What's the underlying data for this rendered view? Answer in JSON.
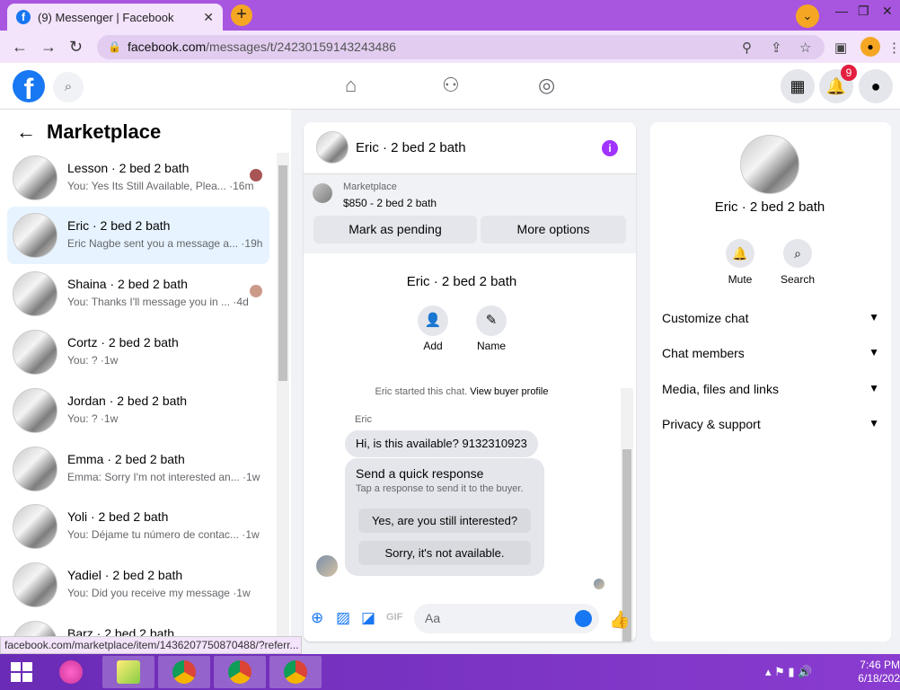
{
  "browser": {
    "tab_title": "(9) Messenger | Facebook",
    "url_host": "facebook.com",
    "url_path": "/messages/t/24230159143243486",
    "status_url": "facebook.com/marketplace/item/1436207750870488/?referr..."
  },
  "header": {
    "notification_count": "9"
  },
  "sidebar": {
    "title": "Marketplace",
    "conversations": [
      {
        "name": "Lesson · 2 bed 2 bath",
        "preview": "You: Yes Its Still Available, Plea... ·16m"
      },
      {
        "name": "Eric · 2 bed 2 bath",
        "preview": "Eric Nagbe sent you a message a... ·19h"
      },
      {
        "name": "Shaina · 2 bed 2 bath",
        "preview": "You: Thanks I'll message you in ... ·4d"
      },
      {
        "name": "Cortz · 2 bed 2 bath",
        "preview": "You: ? ·1w"
      },
      {
        "name": "Jordan · 2 bed 2 bath",
        "preview": "You: ? ·1w"
      },
      {
        "name": "Emma · 2 bed 2 bath",
        "preview": "Emma: Sorry I'm not interested an... ·1w"
      },
      {
        "name": "Yoli · 2 bed 2 bath",
        "preview": "You: Déjame tu número de contac... ·1w"
      },
      {
        "name": "Yadiel · 2 bed 2 bath",
        "preview": "You: Did you receive my message ·1w"
      },
      {
        "name": "Barz · 2 bed 2 bath",
        "preview": ""
      }
    ]
  },
  "chat": {
    "title": "Eric · 2 bed 2 bath",
    "listing_label": "Marketplace",
    "listing_price": "$850 - 2 bed 2 bath",
    "mark_pending": "Mark as pending",
    "more_options": "More options",
    "big_name": "Eric · 2 bed 2 bath",
    "add_label": "Add",
    "name_label": "Name",
    "started_text": "Eric started this chat.",
    "view_profile": "View buyer profile",
    "sender": "Eric",
    "message": "Hi, is this available? 9132310923",
    "quick_title": "Send a quick response",
    "quick_sub": "Tap a response to send it to the buyer.",
    "quick_1": "Yes, are you still interested?",
    "quick_2": "Sorry, it's not available.",
    "composer_placeholder": "Aa"
  },
  "details": {
    "name": "Eric · 2 bed 2 bath",
    "mute": "Mute",
    "search": "Search",
    "sections": [
      "Customize chat",
      "Chat members",
      "Media, files and links",
      "Privacy & support"
    ]
  },
  "taskbar": {
    "time": "7:46 PM",
    "date": "6/18/202"
  }
}
